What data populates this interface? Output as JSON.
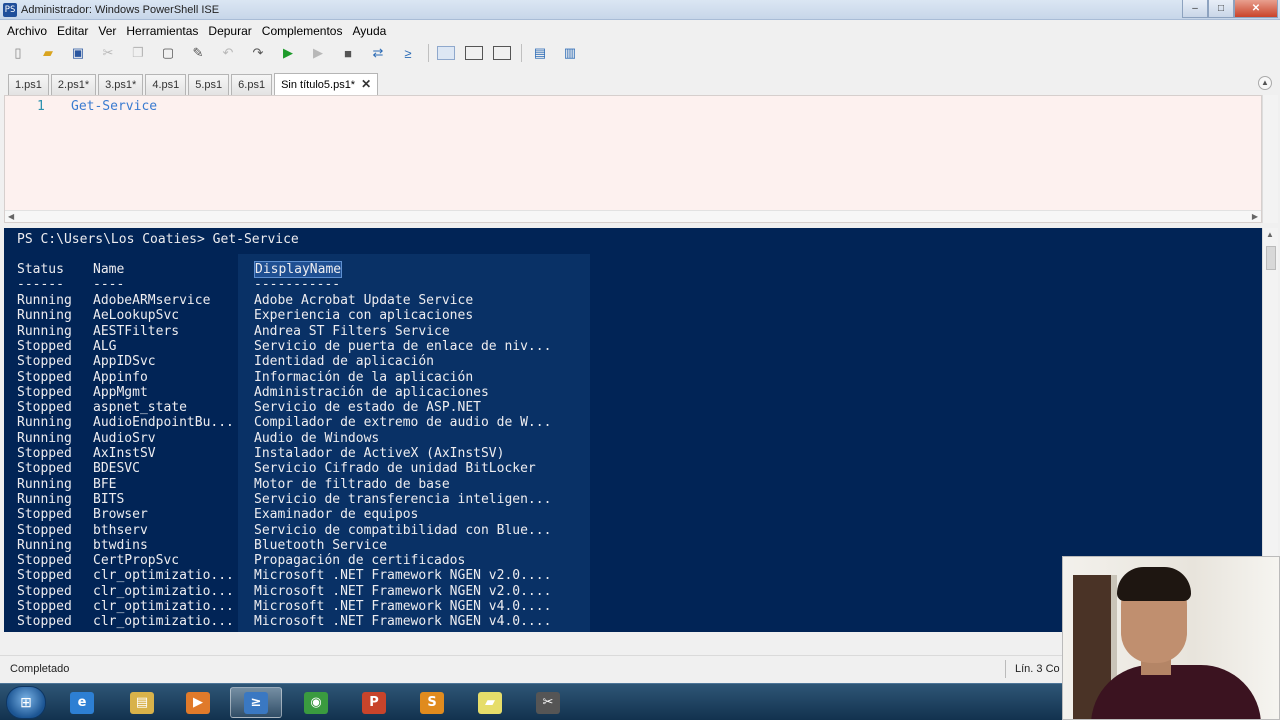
{
  "window": {
    "title": "Administrador: Windows PowerShell ISE",
    "app_icon": "PS",
    "buttons": {
      "minimize": "–",
      "maximize": "□",
      "close": "✕"
    }
  },
  "menu": [
    "Archivo",
    "Editar",
    "Ver",
    "Herramientas",
    "Depurar",
    "Complementos",
    "Ayuda"
  ],
  "toolbar": {
    "icons": [
      "new-file-icon",
      "open-folder-icon",
      "save-icon",
      "cut-icon",
      "copy-icon",
      "paste-icon",
      "clear-icon",
      "undo-icon",
      "redo-icon",
      "run-icon",
      "run-selection-icon",
      "stop-icon",
      "remote-icon",
      "powershell-icon",
      "layout-top-icon",
      "layout-right-icon",
      "layout-max-icon",
      "show-script-icon",
      "show-console-icon"
    ]
  },
  "tabs": [
    "1.ps1",
    "2.ps1*",
    "3.ps1*",
    "4.ps1",
    "5.ps1",
    "6.ps1",
    "Sin título5.ps1*"
  ],
  "active_tab_close": "✕",
  "editor": {
    "line_number": "1",
    "code": "Get-Service"
  },
  "console": {
    "prompt": "PS C:\\Users\\Los Coaties> Get-Service",
    "headers": {
      "status": "Status",
      "name": "Name",
      "display": "DisplayName"
    },
    "underline": {
      "status": "------",
      "name": "----",
      "display": "-----------"
    },
    "rows": [
      {
        "status": "Running",
        "name": "AdobeARMservice",
        "display": "Adobe Acrobat Update Service"
      },
      {
        "status": "Running",
        "name": "AeLookupSvc",
        "display": "Experiencia con aplicaciones"
      },
      {
        "status": "Running",
        "name": "AESTFilters",
        "display": "Andrea ST Filters Service"
      },
      {
        "status": "Stopped",
        "name": "ALG",
        "display": "Servicio de puerta de enlace de niv..."
      },
      {
        "status": "Stopped",
        "name": "AppIDSvc",
        "display": "Identidad de aplicación"
      },
      {
        "status": "Stopped",
        "name": "Appinfo",
        "display": "Información de la aplicación"
      },
      {
        "status": "Stopped",
        "name": "AppMgmt",
        "display": "Administración de aplicaciones"
      },
      {
        "status": "Stopped",
        "name": "aspnet_state",
        "display": "Servicio de estado de ASP.NET"
      },
      {
        "status": "Running",
        "name": "AudioEndpointBu...",
        "display": "Compilador de extremo de audio de W..."
      },
      {
        "status": "Running",
        "name": "AudioSrv",
        "display": "Audio de Windows"
      },
      {
        "status": "Stopped",
        "name": "AxInstSV",
        "display": "Instalador de ActiveX (AxInstSV)"
      },
      {
        "status": "Stopped",
        "name": "BDESVC",
        "display": "Servicio Cifrado de unidad BitLocker"
      },
      {
        "status": "Running",
        "name": "BFE",
        "display": "Motor de filtrado de base"
      },
      {
        "status": "Running",
        "name": "BITS",
        "display": "Servicio de transferencia inteligen..."
      },
      {
        "status": "Stopped",
        "name": "Browser",
        "display": "Examinador de equipos"
      },
      {
        "status": "Stopped",
        "name": "bthserv",
        "display": "Servicio de compatibilidad con Blue..."
      },
      {
        "status": "Running",
        "name": "btwdins",
        "display": "Bluetooth Service"
      },
      {
        "status": "Stopped",
        "name": "CertPropSvc",
        "display": "Propagación de certificados"
      },
      {
        "status": "Stopped",
        "name": "clr_optimizatio...",
        "display": "Microsoft .NET Framework NGEN v2.0...."
      },
      {
        "status": "Stopped",
        "name": "clr_optimizatio...",
        "display": "Microsoft .NET Framework NGEN v2.0...."
      },
      {
        "status": "Stopped",
        "name": "clr_optimizatio...",
        "display": "Microsoft .NET Framework NGEN v4.0...."
      },
      {
        "status": "Stopped",
        "name": "clr_optimizatio...",
        "display": "Microsoft .NET Framework NGEN v4.0...."
      }
    ]
  },
  "statusbar": {
    "text": "Completado",
    "position": "Lín. 3 Co"
  },
  "taskbar": {
    "apps": [
      {
        "name": "internet-explorer",
        "glyph": "e",
        "color": "#2d7fd3",
        "active": false
      },
      {
        "name": "file-explorer",
        "glyph": "▤",
        "color": "#d8b24a",
        "active": false
      },
      {
        "name": "media-player",
        "glyph": "▶",
        "color": "#e07a2a",
        "active": false
      },
      {
        "name": "powershell-ise",
        "glyph": "≥",
        "color": "#3a78c2",
        "active": true
      },
      {
        "name": "chrome",
        "glyph": "◉",
        "color": "#3a9b3f",
        "active": false
      },
      {
        "name": "powerpoint",
        "glyph": "P",
        "color": "#c8442b",
        "active": false
      },
      {
        "name": "sublime-text",
        "glyph": "S",
        "color": "#e08b1e",
        "active": false
      },
      {
        "name": "sticky-notes",
        "glyph": "▰",
        "color": "#e6dd6a",
        "active": false
      },
      {
        "name": "snipping-tool",
        "glyph": "✂",
        "color": "#555555",
        "active": false
      }
    ]
  }
}
